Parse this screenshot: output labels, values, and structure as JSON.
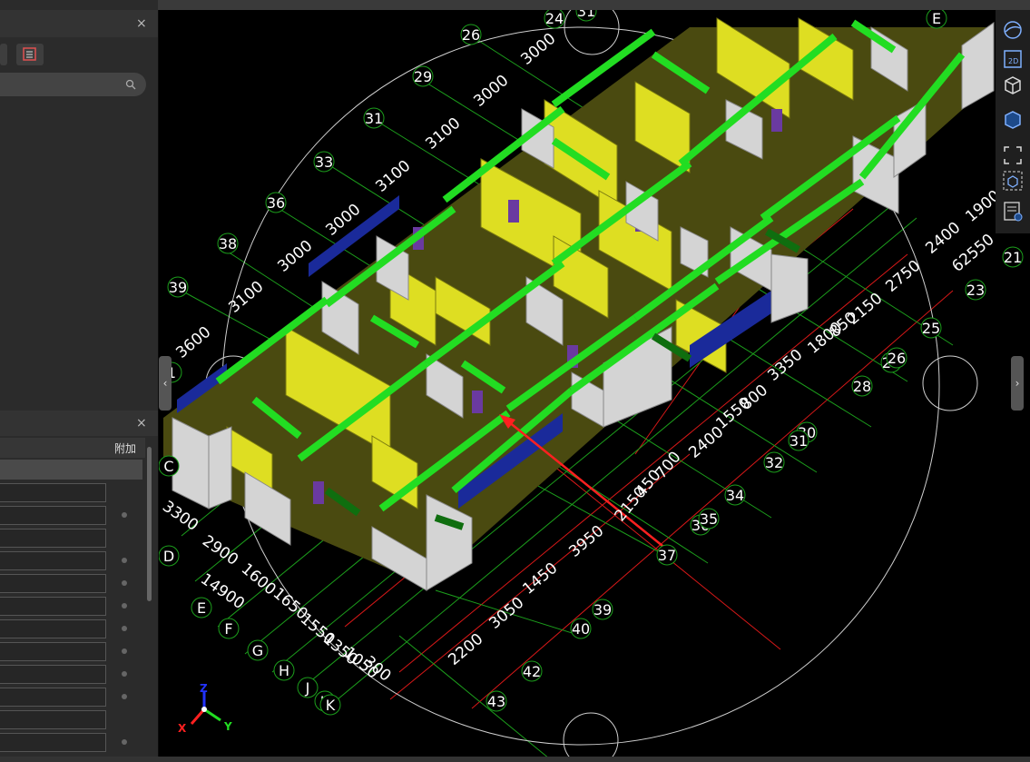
{
  "left_panel_top": {
    "close_glyph": "×"
  },
  "left_panel_bottom": {
    "close_glyph": "×",
    "column_header": "附加"
  },
  "viewport": {
    "grid_bubbles": [
      "24",
      "31",
      "26",
      "29",
      "31",
      "33",
      "36",
      "38",
      "39",
      "1",
      "C",
      "D",
      "E",
      "F",
      "G",
      "H",
      "J",
      "K",
      "K",
      "21",
      "23",
      "25",
      "27",
      "26",
      "28",
      "30",
      "31",
      "32",
      "34",
      "36",
      "35",
      "37",
      "39",
      "40",
      "42",
      "43",
      "E"
    ],
    "dimensions": [
      "3000",
      "3000",
      "3100",
      "3100",
      "3000",
      "3000",
      "3100",
      "3600",
      "3300",
      "2900",
      "14900",
      "1600",
      "1650",
      "1550",
      "1350",
      "1050",
      "300",
      "2200",
      "3050",
      "1450",
      "3950",
      "2150",
      "450",
      "700",
      "2400",
      "1550",
      "800",
      "3350",
      "1800",
      "850",
      "2150",
      "2750",
      "2400",
      "1900",
      "62550"
    ],
    "axis": {
      "x": "X",
      "y": "Y",
      "z": "Z"
    }
  },
  "toolbar": {
    "icons": [
      "sphere-view-icon",
      "2d-view-icon",
      "3d-box-icon",
      "3d-solid-icon",
      "fit-view-icon",
      "cube-select-icon",
      "properties-list-icon"
    ],
    "label_2d": "2D"
  },
  "colors": {
    "wall_yellow": "#dede22",
    "beam_green": "#22dd22",
    "wall_grey": "#d4d4d4",
    "grid_green": "#1c9e1c",
    "grid_red": "#e01818"
  }
}
